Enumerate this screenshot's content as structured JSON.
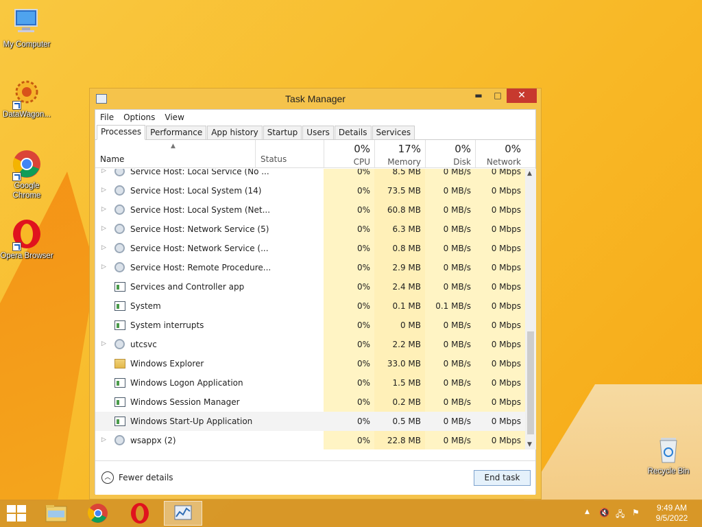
{
  "desktop": {
    "icons": [
      {
        "label": "My Computer"
      },
      {
        "label": "DataWagon..."
      },
      {
        "label": "Google Chrome"
      },
      {
        "label": "Opera Browser"
      },
      {
        "label": "Recycle Bin"
      }
    ]
  },
  "window": {
    "title": "Task Manager",
    "controls": {
      "minimize": "▬",
      "maximize": "□",
      "close": "✕"
    },
    "menu": [
      "File",
      "Options",
      "View"
    ],
    "tabs": [
      "Processes",
      "Performance",
      "App history",
      "Startup",
      "Users",
      "Details",
      "Services"
    ],
    "active_tab": "Processes",
    "columns": {
      "name": "Name",
      "status": "Status",
      "cpu": {
        "pct": "0%",
        "label": "CPU"
      },
      "memory": {
        "pct": "17%",
        "label": "Memory"
      },
      "disk": {
        "pct": "0%",
        "label": "Disk"
      },
      "network": {
        "pct": "0%",
        "label": "Network"
      }
    },
    "rows": [
      {
        "name": "Service Host: Local Service (No ...",
        "icon": "gear-icon",
        "expandable": true,
        "cpu": "0%",
        "mem": "8.5 MB",
        "disk": "0 MB/s",
        "net": "0 Mbps"
      },
      {
        "name": "Service Host: Local System (14)",
        "icon": "gear-icon",
        "expandable": true,
        "cpu": "0%",
        "mem": "73.5 MB",
        "disk": "0 MB/s",
        "net": "0 Mbps"
      },
      {
        "name": "Service Host: Local System (Net...",
        "icon": "gear-icon",
        "expandable": true,
        "cpu": "0%",
        "mem": "60.8 MB",
        "disk": "0 MB/s",
        "net": "0 Mbps"
      },
      {
        "name": "Service Host: Network Service (5)",
        "icon": "gear-icon",
        "expandable": true,
        "cpu": "0%",
        "mem": "6.3 MB",
        "disk": "0 MB/s",
        "net": "0 Mbps"
      },
      {
        "name": "Service Host: Network Service (...",
        "icon": "gear-icon",
        "expandable": true,
        "cpu": "0%",
        "mem": "0.8 MB",
        "disk": "0 MB/s",
        "net": "0 Mbps"
      },
      {
        "name": "Service Host: Remote Procedure...",
        "icon": "gear-icon",
        "expandable": true,
        "cpu": "0%",
        "mem": "2.9 MB",
        "disk": "0 MB/s",
        "net": "0 Mbps"
      },
      {
        "name": "Services and Controller app",
        "icon": "app-icon",
        "expandable": false,
        "cpu": "0%",
        "mem": "2.4 MB",
        "disk": "0 MB/s",
        "net": "0 Mbps"
      },
      {
        "name": "System",
        "icon": "app-icon",
        "expandable": false,
        "cpu": "0%",
        "mem": "0.1 MB",
        "disk": "0.1 MB/s",
        "net": "0 Mbps"
      },
      {
        "name": "System interrupts",
        "icon": "app-icon",
        "expandable": false,
        "cpu": "0%",
        "mem": "0 MB",
        "disk": "0 MB/s",
        "net": "0 Mbps"
      },
      {
        "name": "utcsvc",
        "icon": "gear-icon",
        "expandable": true,
        "cpu": "0%",
        "mem": "2.2 MB",
        "disk": "0 MB/s",
        "net": "0 Mbps"
      },
      {
        "name": "Windows Explorer",
        "icon": "folder-icon",
        "expandable": false,
        "cpu": "0%",
        "mem": "33.0 MB",
        "disk": "0 MB/s",
        "net": "0 Mbps"
      },
      {
        "name": "Windows Logon Application",
        "icon": "app-icon",
        "expandable": false,
        "cpu": "0%",
        "mem": "1.5 MB",
        "disk": "0 MB/s",
        "net": "0 Mbps"
      },
      {
        "name": "Windows Session Manager",
        "icon": "app-icon",
        "expandable": false,
        "cpu": "0%",
        "mem": "0.2 MB",
        "disk": "0 MB/s",
        "net": "0 Mbps"
      },
      {
        "name": "Windows Start-Up Application",
        "icon": "app-icon",
        "expandable": false,
        "cpu": "0%",
        "mem": "0.5 MB",
        "disk": "0 MB/s",
        "net": "0 Mbps",
        "selected": true
      },
      {
        "name": "wsappx (2)",
        "icon": "gear-icon",
        "expandable": true,
        "cpu": "0%",
        "mem": "22.8 MB",
        "disk": "0 MB/s",
        "net": "0 Mbps"
      }
    ],
    "footer": {
      "fewer_details": "Fewer details",
      "end_task": "End task"
    }
  },
  "taskbar": {
    "clock_time": "9:49 AM",
    "clock_date": "9/5/2022"
  },
  "colors": {
    "accent": "#f8b826",
    "close": "#c7392e",
    "cell_highlight": "#fff4c4"
  }
}
